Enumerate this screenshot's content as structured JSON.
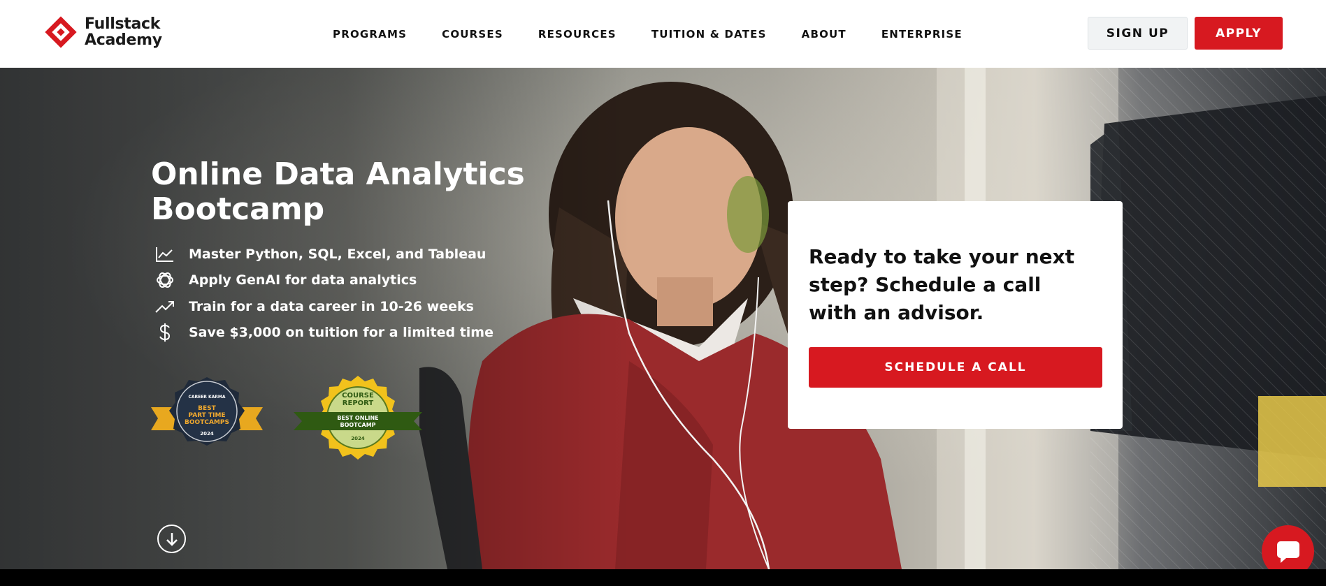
{
  "logo": {
    "line1": "Fullstack",
    "line2": "Academy",
    "brand_color": "#d71920",
    "icon": "fullstack-logo-icon"
  },
  "nav": {
    "items": [
      {
        "label": "PROGRAMS"
      },
      {
        "label": "COURSES"
      },
      {
        "label": "RESOURCES"
      },
      {
        "label": "TUITION & DATES"
      },
      {
        "label": "ABOUT"
      },
      {
        "label": "ENTERPRISE"
      }
    ],
    "signup_label": "SIGN UP",
    "apply_label": "APPLY"
  },
  "hero": {
    "title": "Online Data Analytics Bootcamp",
    "features": [
      {
        "icon": "line-chart-icon",
        "text": "Master Python, SQL, Excel, and Tableau"
      },
      {
        "icon": "openai-icon",
        "text": "Apply GenAI for data analytics"
      },
      {
        "icon": "trending-up-icon",
        "text": "Train for a data career in 10-26 weeks"
      },
      {
        "icon": "dollar-icon",
        "text": "Save $3,000 on tuition for a limited time"
      }
    ],
    "badges": {
      "career_karma": {
        "brand": "CAREER KARMA",
        "line1": "BEST",
        "line2": "PART TIME",
        "line3": "BOOTCAMPS",
        "year": "2024"
      },
      "course_report": {
        "line1": "COURSE",
        "line2": "REPORT",
        "ribbon1": "BEST ONLINE",
        "ribbon2": "BOOTCAMP",
        "year": "2024"
      }
    }
  },
  "card": {
    "title": "Ready to take your next step? Schedule a call with an advisor.",
    "button_label": "SCHEDULE A CALL"
  },
  "colors": {
    "accent": "#d71920",
    "signup_bg": "#f1f3f4"
  }
}
